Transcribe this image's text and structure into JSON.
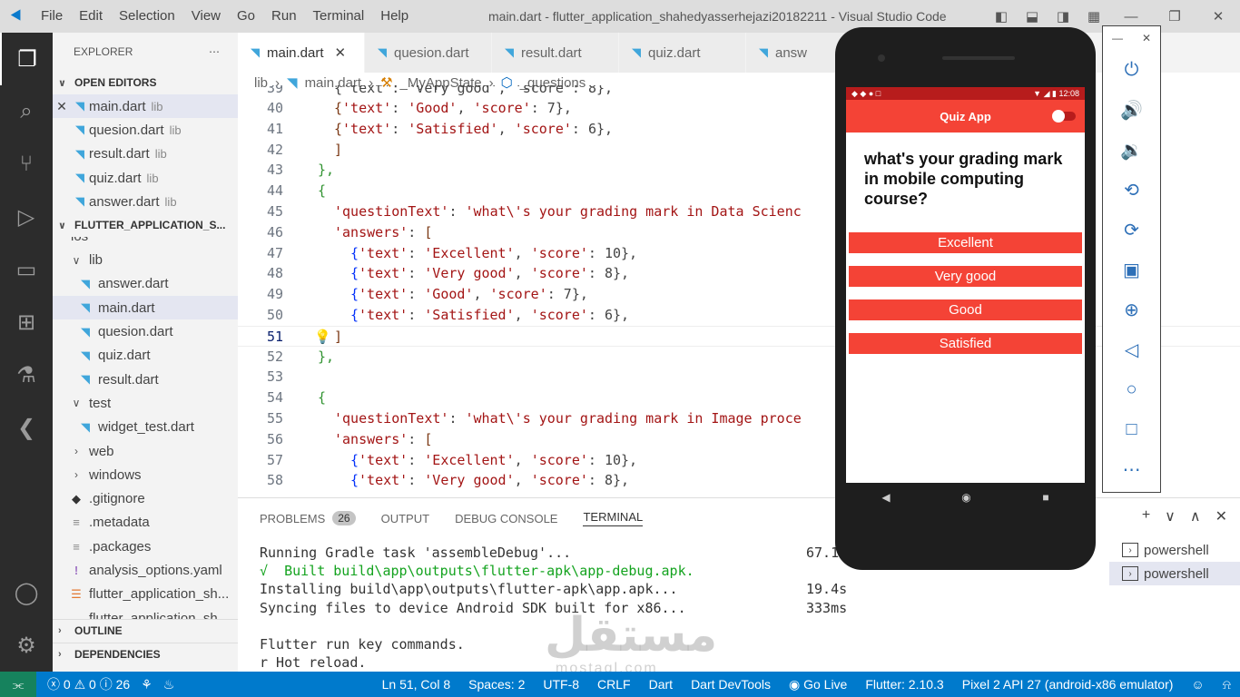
{
  "window": {
    "title": "main.dart - flutter_application_shahedyasserhejazi20182211 - Visual Studio Code",
    "menu": [
      "File",
      "Edit",
      "Selection",
      "View",
      "Go",
      "Run",
      "Terminal",
      "Help"
    ]
  },
  "sidebar": {
    "header": "EXPLORER",
    "open_editors_title": "OPEN EDITORS",
    "open_editors": [
      {
        "name": "main.dart",
        "desc": "lib"
      },
      {
        "name": "quesion.dart",
        "desc": "lib"
      },
      {
        "name": "result.dart",
        "desc": "lib"
      },
      {
        "name": "quiz.dart",
        "desc": "lib"
      },
      {
        "name": "answer.dart",
        "desc": "lib"
      }
    ],
    "project_title": "FLUTTER_APPLICATION_S...",
    "ios": "ios",
    "lib": "lib",
    "lib_files": [
      "answer.dart",
      "main.dart",
      "quesion.dart",
      "quiz.dart",
      "result.dart"
    ],
    "test": "test",
    "test_file": "widget_test.dart",
    "web": "web",
    "windows": "windows",
    "root_files": [
      ".gitignore",
      ".metadata",
      ".packages",
      "analysis_options.yaml",
      "flutter_application_sh...",
      "flutter_application_sh..."
    ],
    "outline": "OUTLINE",
    "dependencies": "DEPENDENCIES"
  },
  "tabs": [
    "main.dart",
    "quesion.dart",
    "result.dart",
    "quiz.dart",
    "answ"
  ],
  "breadcrumb": [
    "lib",
    "main.dart",
    "_MyAppState",
    "_questions"
  ],
  "code": {
    "line_numbers": [
      "39",
      "40",
      "41",
      "42",
      "43",
      "44",
      "45",
      "46",
      "47",
      "48",
      "49",
      "50",
      "51",
      "52",
      "53",
      "54",
      "55",
      "56",
      "57",
      "58"
    ],
    "l39": "{'text': 'Very good', 'score': 8},",
    "l40a": "{",
    "l40b": "'text'",
    "l40c": ": ",
    "l40d": "'Good'",
    "l40e": ", ",
    "l40f": "'score'",
    "l40g": ": 7},",
    "l41a": "{",
    "l41b": "'text'",
    "l41c": ": ",
    "l41d": "'Satisfied'",
    "l41e": ", ",
    "l41f": "'score'",
    "l41g": ": 6},",
    "l42": "]",
    "l43": "},",
    "l44": "{",
    "l45a": "'questionText'",
    "l45b": ": ",
    "l45c": "'what\\'s your grading mark in Data Scienc",
    "l46a": "'answers'",
    "l46b": ": ",
    "l46c": "[",
    "l47a": "{",
    "l47b": "'text'",
    "l47c": ": ",
    "l47d": "'Excellent'",
    "l47e": ", ",
    "l47f": "'score'",
    "l47g": ": 10},",
    "l48a": "{",
    "l48b": "'text'",
    "l48c": ": ",
    "l48d": "'Very good'",
    "l48e": ", ",
    "l48f": "'score'",
    "l48g": ": 8},",
    "l49a": "{",
    "l49b": "'text'",
    "l49c": ": ",
    "l49d": "'Good'",
    "l49e": ", ",
    "l49f": "'score'",
    "l49g": ": 7},",
    "l50a": "{",
    "l50b": "'text'",
    "l50c": ": ",
    "l50d": "'Satisfied'",
    "l50e": ", ",
    "l50f": "'score'",
    "l50g": ": 6},",
    "l51": "]",
    "l52": "},",
    "l53": "",
    "l54": "{",
    "l55a": "'questionText'",
    "l55b": ": ",
    "l55c": "'what\\'s your grading mark in Image proce",
    "l56a": "'answers'",
    "l56b": ": ",
    "l56c": "[",
    "l57a": "{",
    "l57b": "'text'",
    "l57c": ": ",
    "l57d": "'Excellent'",
    "l57e": ", ",
    "l57f": "'score'",
    "l57g": ": 10},",
    "l58a": "{",
    "l58b": "'text'",
    "l58c": ": ",
    "l58d": "'Very good'",
    "l58e": ", ",
    "l58f": "'score'",
    "l58g": ": 8},"
  },
  "panel": {
    "tabs": [
      "PROBLEMS",
      "OUTPUT",
      "DEBUG CONSOLE",
      "TERMINAL"
    ],
    "problems_count": "26",
    "terminal_lines": [
      {
        "text": "Running Gradle task 'assembleDebug'...",
        "time": "67.1"
      },
      {
        "text": "√  Built build\\app\\outputs\\flutter-apk\\app-debug.apk.",
        "time": ""
      },
      {
        "text": "Installing build\\app\\outputs\\flutter-apk\\app.apk...",
        "time": "19.4s"
      },
      {
        "text": "Syncing files to device Android SDK built for x86...",
        "time": "333ms"
      },
      {
        "text": "",
        "time": ""
      },
      {
        "text": "Flutter run key commands.",
        "time": ""
      },
      {
        "text": "r Hot reload.",
        "time": ""
      }
    ],
    "shells": [
      "powershell",
      "powershell"
    ]
  },
  "watermark": {
    "arabic": "مستقل",
    "latin": "mostaql.com"
  },
  "status": {
    "errors": "0",
    "warnings": "0",
    "info": "26",
    "position": "Ln 51, Col 8",
    "spaces": "Spaces: 2",
    "encoding": "UTF-8",
    "eol": "CRLF",
    "language": "Dart",
    "devtools": "Dart DevTools",
    "golive": "Go Live",
    "flutter": "Flutter: 2.10.3",
    "device": "Pixel 2 API 27 (android-x86 emulator)"
  },
  "phone": {
    "clock": "12:08",
    "app_title": "Quiz App",
    "question": "what's your grading mark in mobile computing course?",
    "answers": [
      "Excellent",
      "Very good",
      "Good",
      "Satisfied"
    ]
  },
  "colors": {
    "accent": "#007acc",
    "app_red": "#f44336",
    "dark_red": "#b71c1c"
  }
}
